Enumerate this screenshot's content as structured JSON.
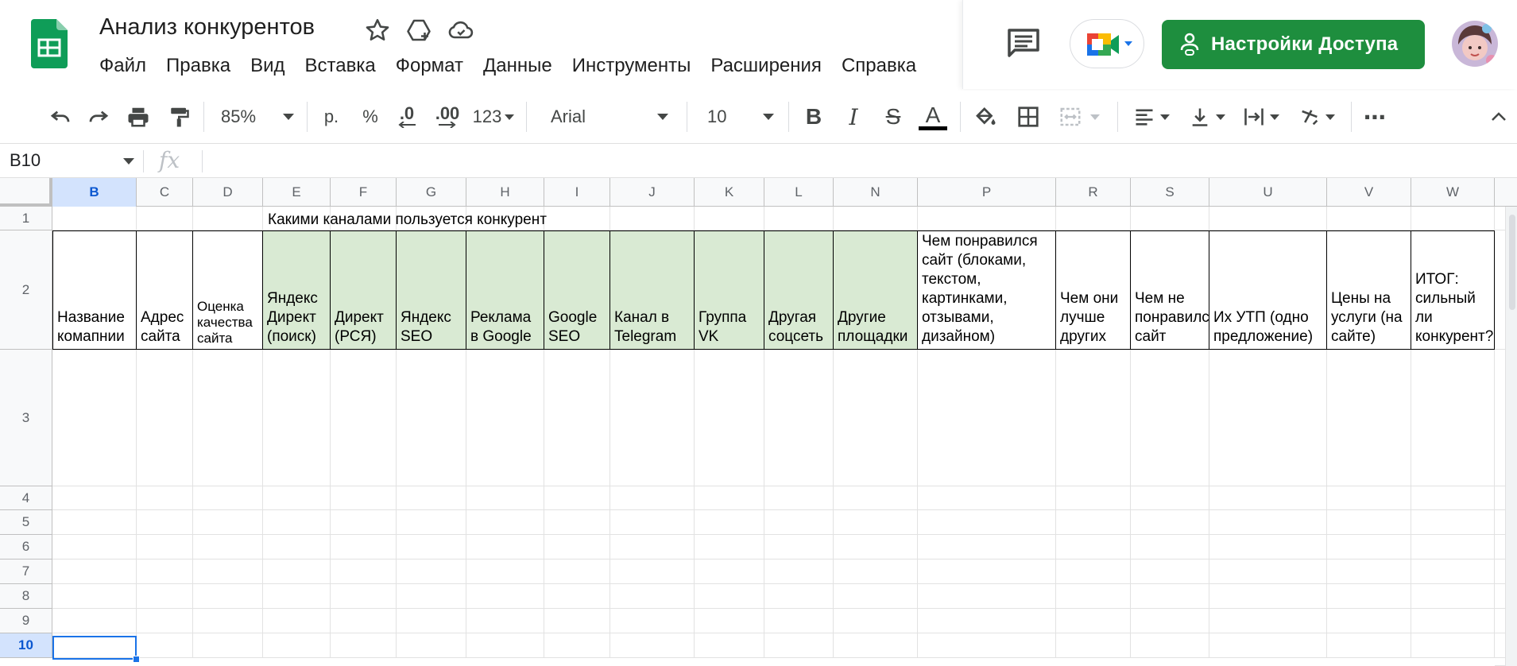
{
  "document": {
    "title": "Анализ конкурентов"
  },
  "menu": [
    "Файл",
    "Правка",
    "Вид",
    "Вставка",
    "Формат",
    "Данные",
    "Инструменты",
    "Расширения",
    "Справка"
  ],
  "share_button": {
    "label": "Настройки Доступа"
  },
  "toolbar": {
    "zoom": "85%",
    "currency": "р.",
    "percent": "%",
    "decrease_decimal": ".0",
    "increase_decimal": ".00",
    "more_formats": "123",
    "font": "Arial",
    "font_size": "10",
    "bold": "B",
    "italic": "I",
    "strikethrough": "S",
    "text_color": "A",
    "more": "⋯"
  },
  "formula_bar": {
    "name_box": "B10",
    "fx": "fx",
    "value": ""
  },
  "grid": {
    "columns": [
      "B",
      "C",
      "D",
      "E",
      "F",
      "G",
      "H",
      "I",
      "J",
      "K",
      "L",
      "N",
      "P",
      "R",
      "S",
      "U",
      "V",
      "W"
    ],
    "selected_column": "B",
    "rows": [
      "1",
      "2",
      "3",
      "4",
      "5",
      "6",
      "7",
      "8",
      "9",
      "10"
    ],
    "selected_row": "10",
    "group_label": "Какими каналами пользуется конкурент",
    "header_cells": [
      "Название комапнии",
      "Адрес сайта",
      "Оценка качества сайта",
      "Яндекс Директ (поиск)",
      "Директ (РСЯ)",
      "Яндекс SEO",
      "Реклама в Google",
      "Google SEO",
      "Канал в Telegram",
      "Группа VK",
      "Другая соцсеть",
      "Другие площадки",
      "Чем понравился сайт (блоками, текстом, картинками, отзывами, дизайном)",
      "Чем они лучше других",
      "Чем не понравился сайт",
      "Их УТП (одно предложение)",
      "Цены на услуги (на сайте)",
      "ИТОГ: сильный ли конкурент?"
    ]
  },
  "colors": {
    "share_green": "#1e8e3e",
    "header_fill_green": "#d9ead3",
    "selection_blue": "#1a73e8",
    "sheets_logo_green": "#0f9d58"
  }
}
